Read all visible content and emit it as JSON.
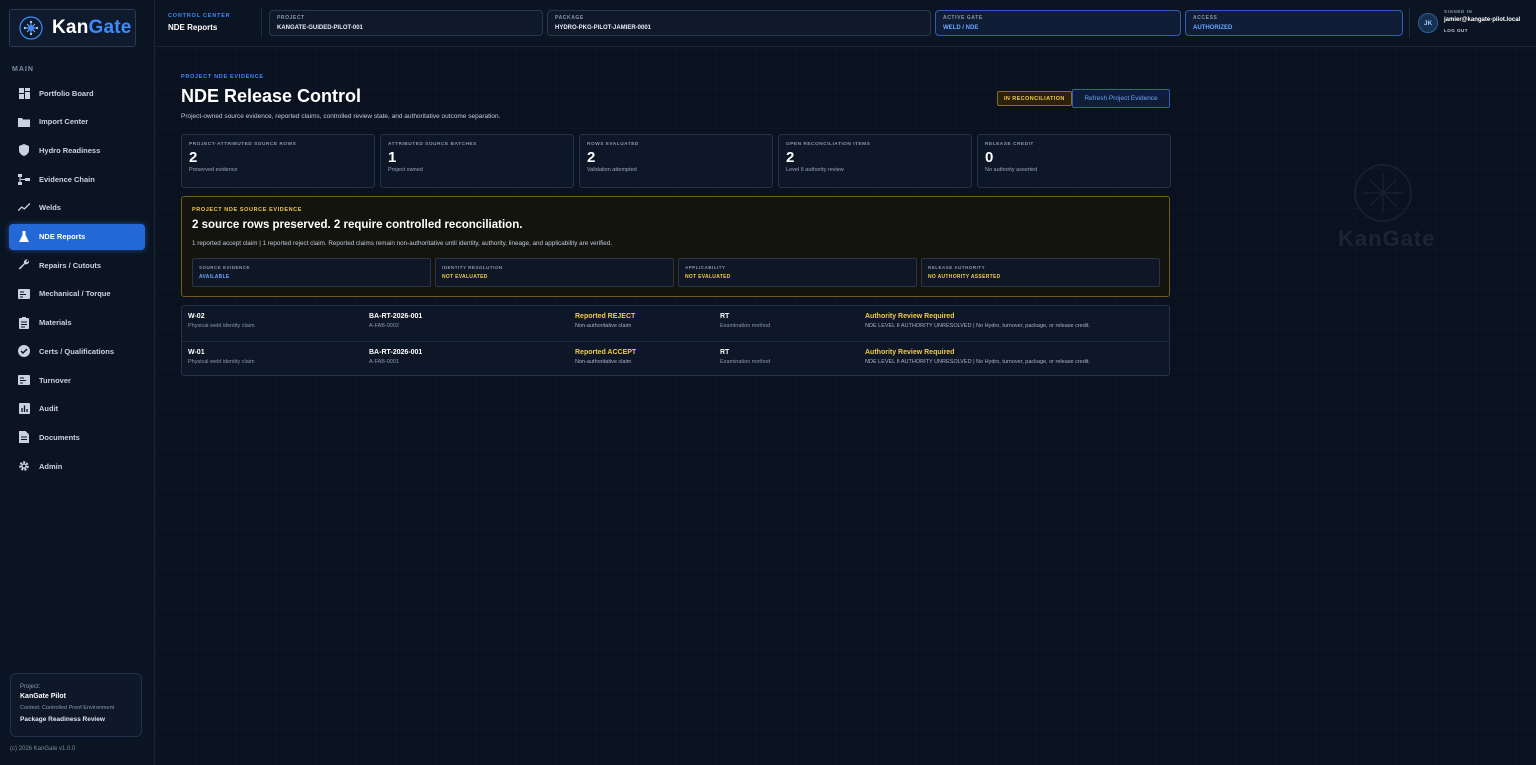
{
  "brand": {
    "name_part1": "Kan",
    "name_part2": "Gate"
  },
  "sidebar": {
    "heading": "MAIN",
    "items": [
      {
        "label": "Portfolio Board",
        "icon": "grid-icon"
      },
      {
        "label": "Import Center",
        "icon": "folder-icon"
      },
      {
        "label": "Hydro Readiness",
        "icon": "shield-icon"
      },
      {
        "label": "Evidence Chain",
        "icon": "hierarchy-icon"
      },
      {
        "label": "Welds",
        "icon": "trend-icon"
      },
      {
        "label": "NDE Reports",
        "icon": "flask-icon",
        "active": true
      },
      {
        "label": "Repairs / Cutouts",
        "icon": "wrench-icon"
      },
      {
        "label": "Mechanical / Torque",
        "icon": "panel-icon"
      },
      {
        "label": "Materials",
        "icon": "clipboard-icon"
      },
      {
        "label": "Certs / Qualifications",
        "icon": "verified-icon"
      },
      {
        "label": "Turnover",
        "icon": "panel-icon"
      },
      {
        "label": "Audit",
        "icon": "bar-chart-icon"
      },
      {
        "label": "Documents",
        "icon": "document-icon"
      },
      {
        "label": "Admin",
        "icon": "gear-icon"
      }
    ],
    "project_card": {
      "label": "Project:",
      "name": "KanGate Pilot",
      "context": "Context: Controlled Proof Environment",
      "review": "Package Readiness Review"
    },
    "copyright": "(c) 2026 KanGate v1.0.0"
  },
  "topbar": {
    "control_center_label": "CONTROL CENTER",
    "control_center_value": "NDE Reports",
    "project_label": "PROJECT",
    "project_value": "KANGATE-GUIDED-PILOT-001",
    "package_label": "PACKAGE",
    "package_value": "HYDRO-PKG-PILOT-JAMIER-0001",
    "gate_label": "ACTIVE GATE",
    "gate_value": "WELD / NDE",
    "access_label": "ACCESS",
    "access_value": "AUTHORIZED",
    "avatar_initials": "JK",
    "signed_in_label": "SIGNED IN",
    "email": "jamier@kangate-pilot.local",
    "logout": "LOG OUT"
  },
  "page": {
    "eyebrow": "PROJECT NDE EVIDENCE",
    "title": "NDE Release Control",
    "subtitle": "Project-owned source evidence, reported claims, controlled review state, and authoritative outcome separation.",
    "status_badge": "IN RECONCILIATION",
    "refresh_button": "Refresh Project Evidence"
  },
  "stats": [
    {
      "label": "PROJECT-ATTRIBUTED SOURCE ROWS",
      "value": "2",
      "sub": "Preserved evidence"
    },
    {
      "label": "ATTRIBUTED SOURCE BATCHES",
      "value": "1",
      "sub": "Project owned"
    },
    {
      "label": "ROWS EVALUATED",
      "value": "2",
      "sub": "Validation attempted"
    },
    {
      "label": "OPEN RECONCILIATION ITEMS",
      "value": "2",
      "sub": "Level II authority review"
    },
    {
      "label": "RELEASE CREDIT",
      "value": "0",
      "sub": "No authority asserted"
    }
  ],
  "evidence": {
    "eyebrow": "PROJECT NDE SOURCE EVIDENCE",
    "headline": "2 source rows preserved. 2 require controlled reconciliation.",
    "detail": "1 reported accept claim | 1 reported reject claim. Reported claims remain non-authoritative until identity, authority, lineage, and applicability are verified.",
    "boxes": [
      {
        "label": "SOURCE EVIDENCE",
        "value": "AVAILABLE",
        "color": "#6aa5ff"
      },
      {
        "label": "IDENTITY RESOLUTION",
        "value": "NOT EVALUATED",
        "color": "#f2c94c"
      },
      {
        "label": "APPLICABILITY",
        "value": "NOT EVALUATED",
        "color": "#f2c94c"
      },
      {
        "label": "RELEASE AUTHORITY",
        "value": "NO AUTHORITY ASSERTED",
        "color": "#f2c94c"
      }
    ]
  },
  "rows": [
    {
      "weld": "W-02",
      "weld_sub": "Physical weld identity claim",
      "report": "BA-RT-2026-001",
      "report_sub": "A-FAB-0002",
      "claim": "Reported REJECT",
      "claim_sub": "Non-authoritative claim",
      "method": "RT",
      "method_sub": "Examination method",
      "status": "Authority Review Required",
      "status_sub": "NDE LEVEL II AUTHORITY UNRESOLVED | No Hydro, turnover, package, or release credit."
    },
    {
      "weld": "W-01",
      "weld_sub": "Physical weld identity claim",
      "report": "BA-RT-2026-001",
      "report_sub": "A-FAB-0001",
      "claim": "Reported ACCEPT",
      "claim_sub": "Non-authoritative claim",
      "method": "RT",
      "method_sub": "Examination method",
      "status": "Authority Review Required",
      "status_sub": "NDE LEVEL II AUTHORITY UNRESOLVED | No Hydro, turnover, package, or release credit."
    }
  ],
  "watermark": "KanGate",
  "colors": {
    "accent": "#3d8bfd",
    "active_nav": "#2468d8",
    "warning": "#f2c94c",
    "background": "#0a1220"
  }
}
